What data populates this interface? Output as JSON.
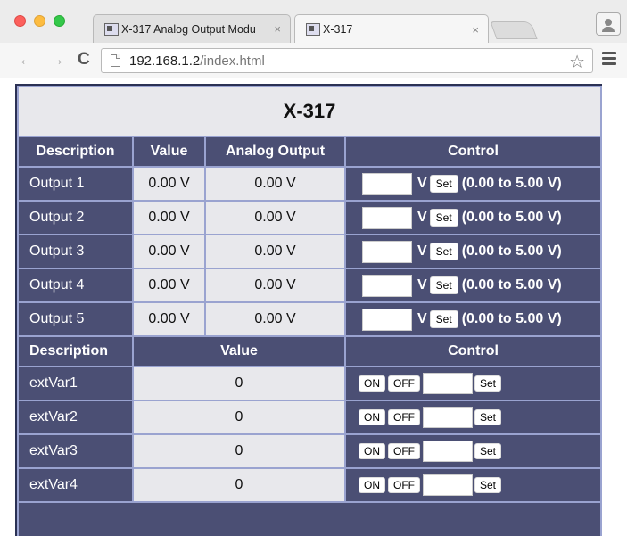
{
  "browser": {
    "tabs": [
      {
        "title": "X-317 Analog Output Modu",
        "close": "×"
      },
      {
        "title": "X-317",
        "close": "×"
      }
    ],
    "url_host": "192.168.1.2",
    "url_path": "/index.html",
    "nav": {
      "back": "←",
      "forward": "→",
      "reload": "C",
      "star": "☆"
    }
  },
  "page": {
    "title": "X-317",
    "outputs_header": {
      "description": "Description",
      "value": "Value",
      "analog_output": "Analog Output",
      "control": "Control"
    },
    "outputs": [
      {
        "description": "Output 1",
        "value": "0.00 V",
        "analog_output": "0.00 V",
        "unit": "V",
        "set_label": "Set",
        "range": "(0.00 to 5.00 V)",
        "input_value": ""
      },
      {
        "description": "Output 2",
        "value": "0.00 V",
        "analog_output": "0.00 V",
        "unit": "V",
        "set_label": "Set",
        "range": "(0.00 to 5.00 V)",
        "input_value": ""
      },
      {
        "description": "Output 3",
        "value": "0.00 V",
        "analog_output": "0.00 V",
        "unit": "V",
        "set_label": "Set",
        "range": "(0.00 to 5.00 V)",
        "input_value": ""
      },
      {
        "description": "Output 4",
        "value": "0.00 V",
        "analog_output": "0.00 V",
        "unit": "V",
        "set_label": "Set",
        "range": "(0.00 to 5.00 V)",
        "input_value": ""
      },
      {
        "description": "Output 5",
        "value": "0.00 V",
        "analog_output": "0.00 V",
        "unit": "V",
        "set_label": "Set",
        "range": "(0.00 to 5.00 V)",
        "input_value": ""
      }
    ],
    "vars_header": {
      "description": "Description",
      "value": "Value",
      "control": "Control"
    },
    "vars": [
      {
        "description": "extVar1",
        "value": "0",
        "on_label": "ON",
        "off_label": "OFF",
        "set_label": "Set",
        "input_value": ""
      },
      {
        "description": "extVar2",
        "value": "0",
        "on_label": "ON",
        "off_label": "OFF",
        "set_label": "Set",
        "input_value": ""
      },
      {
        "description": "extVar3",
        "value": "0",
        "on_label": "ON",
        "off_label": "OFF",
        "set_label": "Set",
        "input_value": ""
      },
      {
        "description": "extVar4",
        "value": "0",
        "on_label": "ON",
        "off_label": "OFF",
        "set_label": "Set",
        "input_value": ""
      }
    ]
  }
}
